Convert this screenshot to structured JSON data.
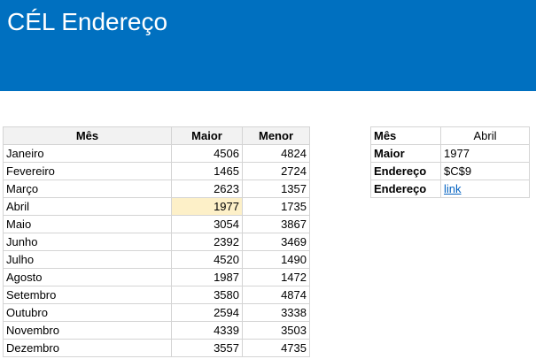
{
  "header": {
    "title": "CÉL Endereço"
  },
  "main_table": {
    "columns": [
      "Mês",
      "Maior",
      "Menor"
    ],
    "rows": [
      {
        "mes": "Janeiro",
        "maior": "4506",
        "menor": "4824"
      },
      {
        "mes": "Fevereiro",
        "maior": "1465",
        "menor": "2724"
      },
      {
        "mes": "Março",
        "maior": "2623",
        "menor": "1357"
      },
      {
        "mes": "Abril",
        "maior": "1977",
        "menor": "1735"
      },
      {
        "mes": "Maio",
        "maior": "3054",
        "menor": "3867"
      },
      {
        "mes": "Junho",
        "maior": "2392",
        "menor": "3469"
      },
      {
        "mes": "Julho",
        "maior": "4520",
        "menor": "1490"
      },
      {
        "mes": "Agosto",
        "maior": "1987",
        "menor": "1472"
      },
      {
        "mes": "Setembro",
        "maior": "3580",
        "menor": "4874"
      },
      {
        "mes": "Outubro",
        "maior": "2594",
        "menor": "3338"
      },
      {
        "mes": "Novembro",
        "maior": "4339",
        "menor": "3503"
      },
      {
        "mes": "Dezembro",
        "maior": "3557",
        "menor": "4735"
      }
    ],
    "highlight_color": "#fdf0c8"
  },
  "lookup": {
    "mes_label": "Mês",
    "mes_value": "Abril",
    "maior_label": "Maior",
    "maior_value": "1977",
    "endereco_label": "Endereço",
    "endereco_value": "$C$9",
    "endereco2_label": "Endereço",
    "endereco2_value": "link"
  },
  "colors": {
    "banner": "#0070c0",
    "link": "#0563c1"
  }
}
